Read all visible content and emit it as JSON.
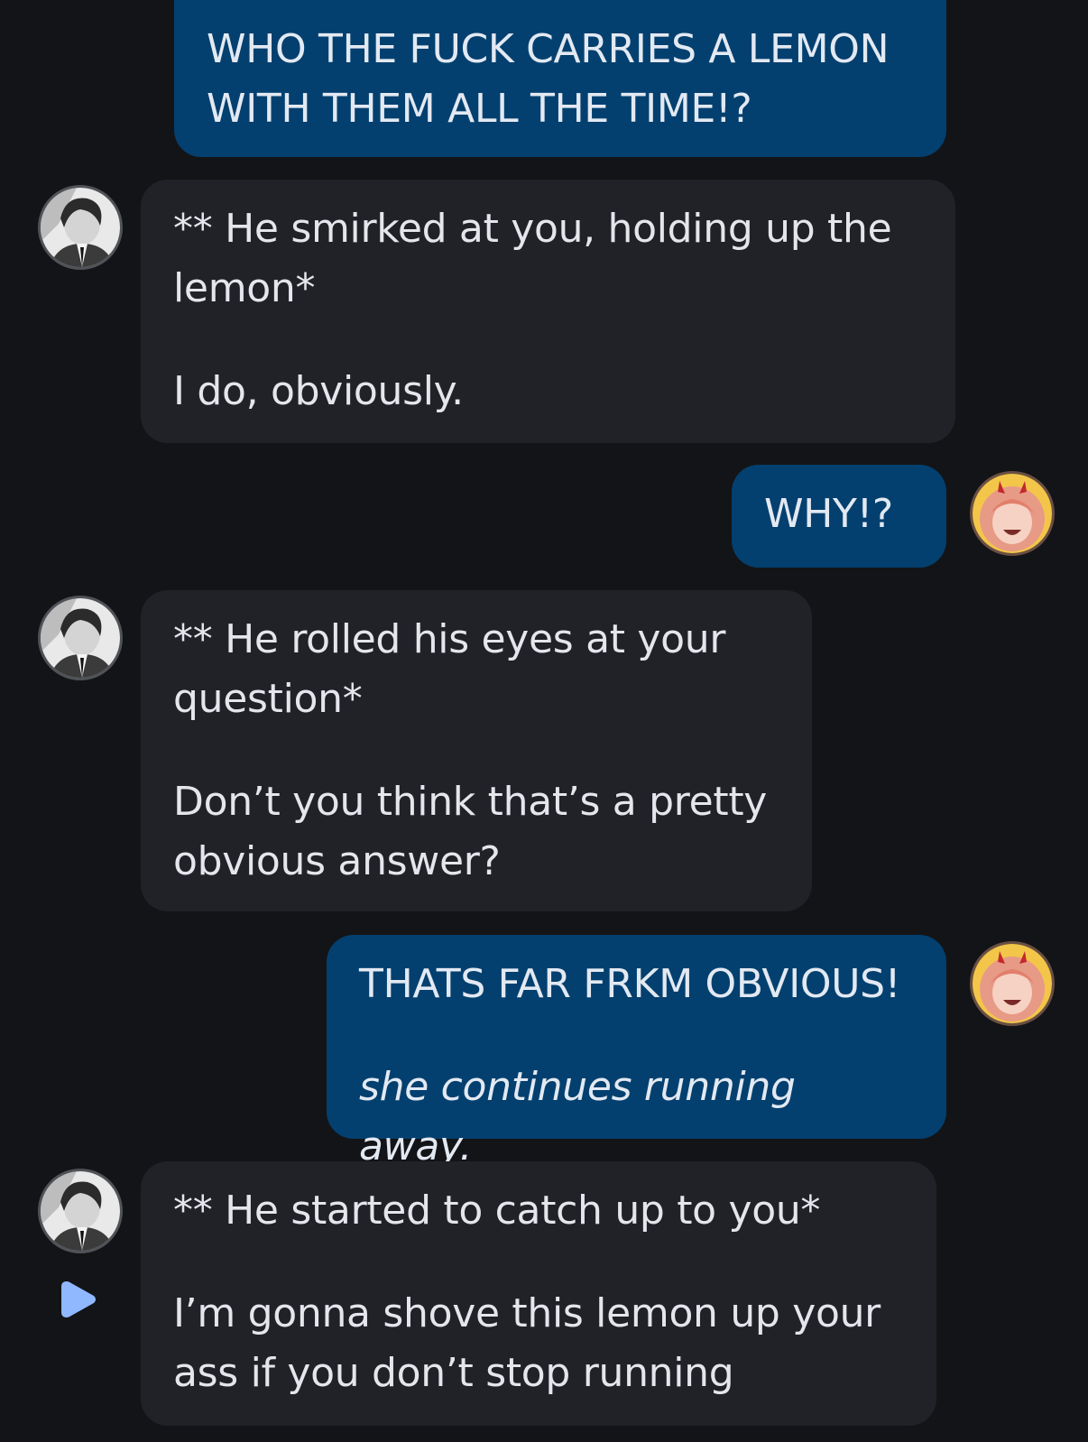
{
  "messages": [
    {
      "role": "user",
      "paragraphs": [
        "WHO THE FUCK CARRIES A LEMON WITH THEM ALL THE TIME!?"
      ]
    },
    {
      "role": "bot",
      "paragraphs": [
        "** He smirked at you, holding up the lemon*",
        "I do, obviously."
      ]
    },
    {
      "role": "user",
      "paragraphs": [
        "WHY!?"
      ]
    },
    {
      "role": "bot",
      "paragraphs": [
        "** He rolled his eyes at your question*",
        "Don’t you think that’s a pretty obvious answer?"
      ]
    },
    {
      "role": "user",
      "paragraphs": [
        "THATS FAR FRKM OBVIOUS!"
      ],
      "italic": "she continues running away."
    },
    {
      "role": "bot",
      "paragraphs": [
        "** He started to catch up to you*",
        "I’m gonna shove this lemon up your ass if you don’t stop running"
      ]
    }
  ],
  "avatars": {
    "bot": "dark-haired-man-avatar",
    "user": "pink-haired-girl-avatar"
  },
  "icons": {
    "play": "play-icon"
  },
  "colors": {
    "background": "#131417",
    "user_bubble": "#03406f",
    "bot_bubble": "#202228",
    "play_icon": "#8fb8ff"
  }
}
